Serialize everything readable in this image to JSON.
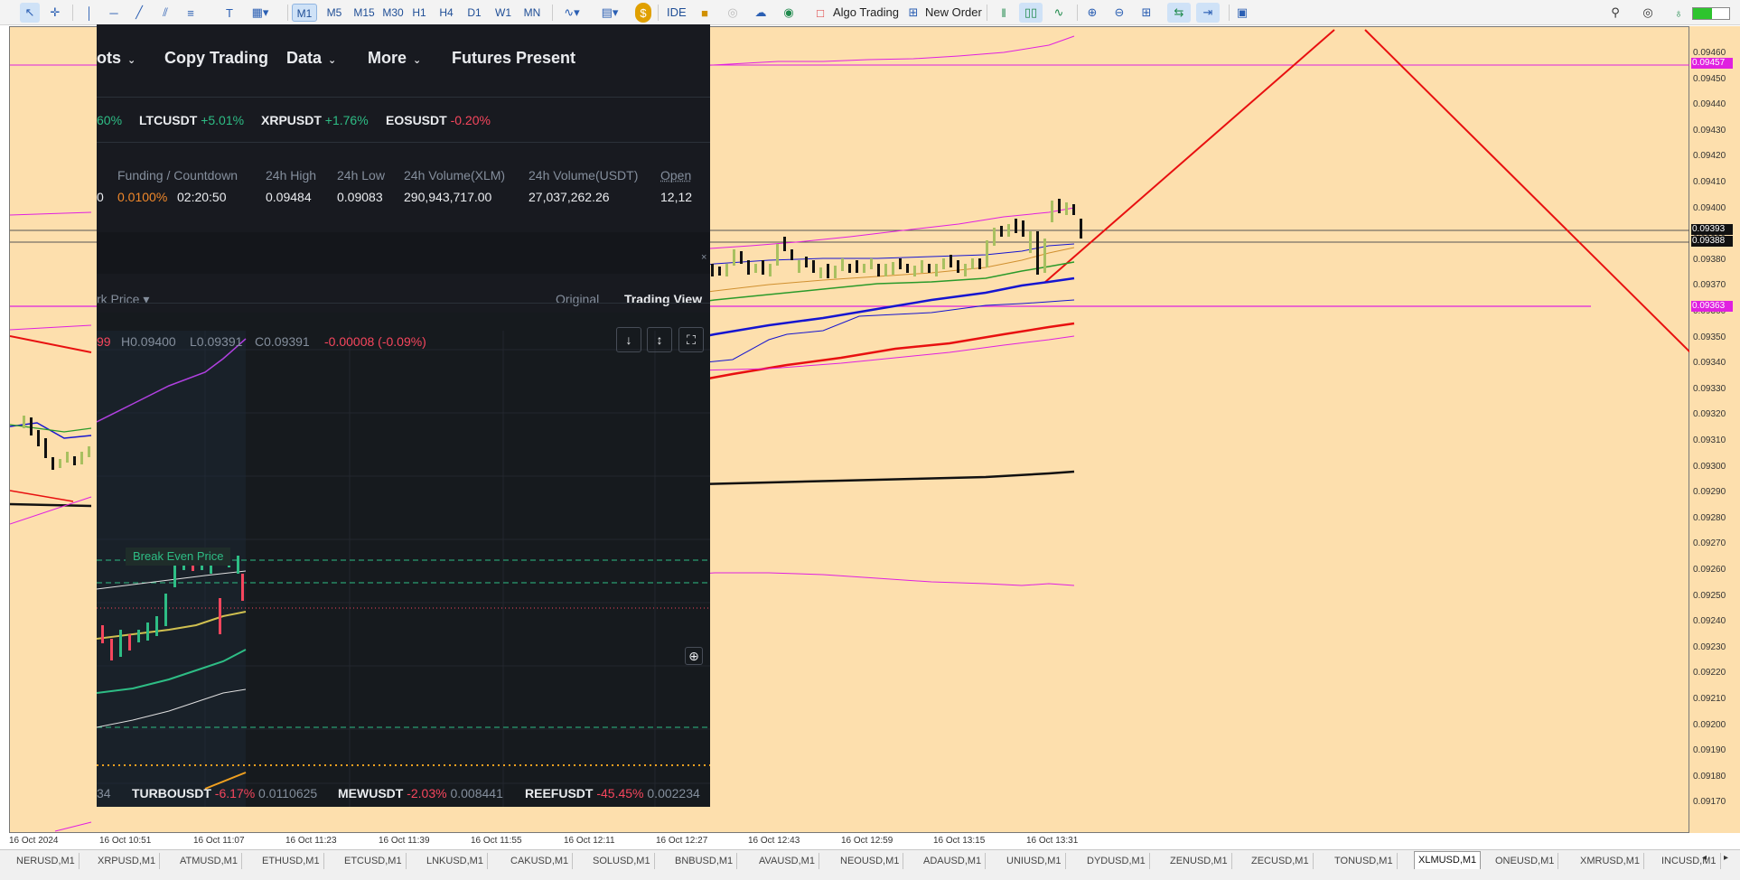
{
  "toolbar": {
    "timeframes": [
      "M1",
      "M5",
      "M15",
      "M30",
      "H1",
      "H4",
      "D1",
      "W1",
      "MN"
    ],
    "active_timeframe": "M1",
    "ide_label": "IDE",
    "algo_trading_label": "Algo Trading",
    "new_order_label": "New Order"
  },
  "chart": {
    "price_labels": [
      "0.09460",
      "0.09450",
      "0.09440",
      "0.09430",
      "0.09420",
      "0.09410",
      "0.09400",
      "0.09390",
      "0.09380",
      "0.09370",
      "0.09360",
      "0.09350",
      "0.09340",
      "0.09330",
      "0.09320",
      "0.09310",
      "0.09300",
      "0.09290",
      "0.09280",
      "0.09270",
      "0.09260",
      "0.09250",
      "0.09240",
      "0.09230",
      "0.09220",
      "0.09210",
      "0.09200",
      "0.09190",
      "0.09180",
      "0.09170"
    ],
    "price_boxes": {
      "top_magenta": "0.09457",
      "bid": "0.09393",
      "ask": "0.09388",
      "mid_magenta": "0.09363"
    },
    "time_labels": [
      "16 Oct 2024",
      "16 Oct 10:51",
      "16 Oct 11:07",
      "16 Oct 11:23",
      "16 Oct 11:39",
      "16 Oct 11:55",
      "16 Oct 12:11",
      "16 Oct 12:27",
      "16 Oct 12:43",
      "16 Oct 12:59",
      "16 Oct 13:15",
      "16 Oct 13:31"
    ],
    "colors": {
      "background": "#fddfad",
      "up_candle": "#a8c060",
      "down_candle": "#111111",
      "ma_blue": "#1515d0",
      "ma_red": "#e81010",
      "ma_green": "#2a9a2a",
      "band": "#e020e0"
    }
  },
  "symbol_tabs": [
    "NERUSD,M1",
    "XRPUSD,M1",
    "ATMUSD,M1",
    "ETHUSD,M1",
    "ETCUSD,M1",
    "LNKUSD,M1",
    "CAKUSD,M1",
    "SOLUSD,M1",
    "BNBUSD,M1",
    "AVAUSD,M1",
    "NEOUSD,M1",
    "ADAUSD,M1",
    "UNIUSD,M1",
    "DYDUSD,M1",
    "ZENUSD,M1",
    "ZECUSD,M1",
    "TONUSD,M1",
    "XLMUSD,M1",
    "ONEUSD,M1",
    "XMRUSD,M1",
    "INCUSD,M1"
  ],
  "active_symbol_tab": "XLMUSD,M1",
  "overlay": {
    "nav": [
      "ots",
      "Copy Trading",
      "Data",
      "More",
      "Futures Present"
    ],
    "ticker": [
      {
        "name": "",
        "change": "60%",
        "dir": "up"
      },
      {
        "name": "LTCUSDT",
        "change": "+5.01%",
        "dir": "up"
      },
      {
        "name": "XRPUSDT",
        "change": "+1.76%",
        "dir": "up"
      },
      {
        "name": "EOSUSDT",
        "change": "-0.20%",
        "dir": "down"
      }
    ],
    "stats_headers": [
      "Funding / Countdown",
      "24h High",
      "24h Low",
      "24h Volume(XLM)",
      "24h Volume(USDT)",
      "Open"
    ],
    "stats": {
      "funding": "0.0100%",
      "countdown": "02:20:50",
      "high": "0.09484",
      "low": "0.09083",
      "vol_xlm": "290,943,717.00",
      "vol_usdt": "27,037,262.26",
      "open": "12,12"
    },
    "stats_prefix": "0",
    "price_type": "rk Price",
    "view_original": "Original",
    "view_trading": "Trading View",
    "ohlc": {
      "o": "99",
      "h": "H0.09400",
      "l": "L0.09391",
      "c": "C0.09391",
      "chg": "-0.00008 (-0.09%)"
    },
    "break_even_label": "Break Even Price",
    "bottom_ticker": [
      {
        "name": "",
        "change": "",
        "price": "34"
      },
      {
        "name": "TURBOUSDT",
        "change": "-6.17%",
        "price": "0.0110625"
      },
      {
        "name": "MEWUSDT",
        "change": "-2.03%",
        "price": "0.008441"
      },
      {
        "name": "REEFUSDT",
        "change": "-45.45%",
        "price": "0.002234"
      }
    ]
  }
}
